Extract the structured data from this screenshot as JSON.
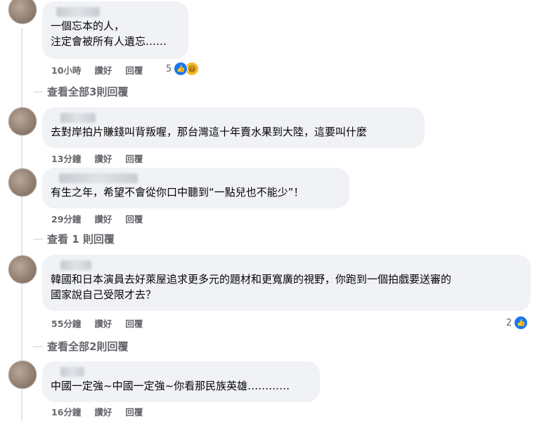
{
  "comments": [
    {
      "text": "一個忘本的人，\n注定會被所有人遺忘……",
      "time": "10小時",
      "like": "讚好",
      "reply": "回覆",
      "reaction_count": "5",
      "reactions": [
        "like",
        "haha"
      ],
      "view_replies": "查看全部3則回覆"
    },
    {
      "text": "去對岸拍片賺錢叫背叛喔，那台灣這十年賣水果到大陸，這要叫什麼",
      "time": "13分鐘",
      "like": "讚好",
      "reply": "回覆"
    },
    {
      "text": "有生之年，希望不會從你口中聽到“一點兒也不能少”！",
      "time": "29分鐘",
      "like": "讚好",
      "reply": "回覆",
      "view_replies": "查看 1 則回覆"
    },
    {
      "text": "韓國和日本演員去好萊屋追求更多元的題材和更寬廣的視野，你跑到一個拍戲要送審的\n國家說自己受限才去？",
      "time": "55分鐘",
      "like": "讚好",
      "reply": "回覆",
      "reaction_count": "2",
      "reactions": [
        "like"
      ],
      "view_replies": "查看全部2則回覆"
    },
    {
      "text": "中國一定強~中國一定強~你看那民族英雄…………",
      "time": "16分鐘",
      "like": "讚好",
      "reply": "回覆"
    }
  ],
  "colors": {
    "bubble": "#f0f2f5",
    "meta": "#65676b",
    "like_blue": "#1877f2",
    "haha_yellow": "#f7b928"
  },
  "icons": {
    "like": "thumbs-up-icon",
    "haha": "laughing-face-icon"
  }
}
